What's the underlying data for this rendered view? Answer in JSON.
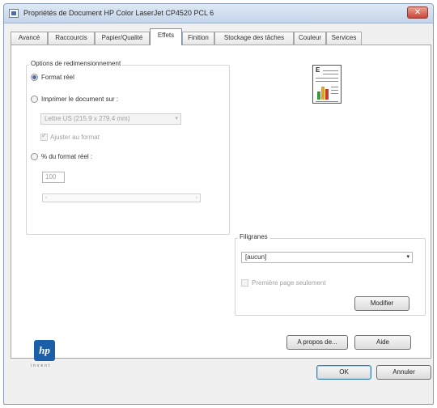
{
  "window": {
    "title": "Propriétés de Document HP Color LaserJet CP4520 PCL 6",
    "close_glyph": "✕"
  },
  "tabs": [
    {
      "label": "Avancé"
    },
    {
      "label": "Raccourcis"
    },
    {
      "label": "Papier/Qualité"
    },
    {
      "label": "Effets",
      "active": true
    },
    {
      "label": "Finition"
    },
    {
      "label": "Stockage des tâches"
    },
    {
      "label": "Couleur"
    },
    {
      "label": "Services"
    }
  ],
  "resize": {
    "group_title": "Options de redimensionnement",
    "option_actual": "Format réel",
    "option_print_on": "Imprimer le document sur :",
    "paper_size": "Lettre US (215.9 x 279.4 mm)",
    "fit_label": "Ajuster au format",
    "option_percent": "% du format réel :",
    "percent_value": "100",
    "slider_left": "‹",
    "slider_right": "›"
  },
  "watermark": {
    "group_title": "Filigranes",
    "selected": "[aucun]",
    "first_page_only": "Première page seulement",
    "edit_button": "Modifier"
  },
  "footer": {
    "about_button": "A propos de...",
    "help_button": "Aide",
    "ok_button": "OK",
    "cancel_button": "Annuler",
    "logo_text": "hp",
    "logo_sub": "invent"
  },
  "icons": {
    "dropdown": "▾",
    "preview_letter": "E"
  },
  "colors": {
    "hp_blue": "#1a5fa8",
    "radio_dot": "#4b6fa6"
  }
}
